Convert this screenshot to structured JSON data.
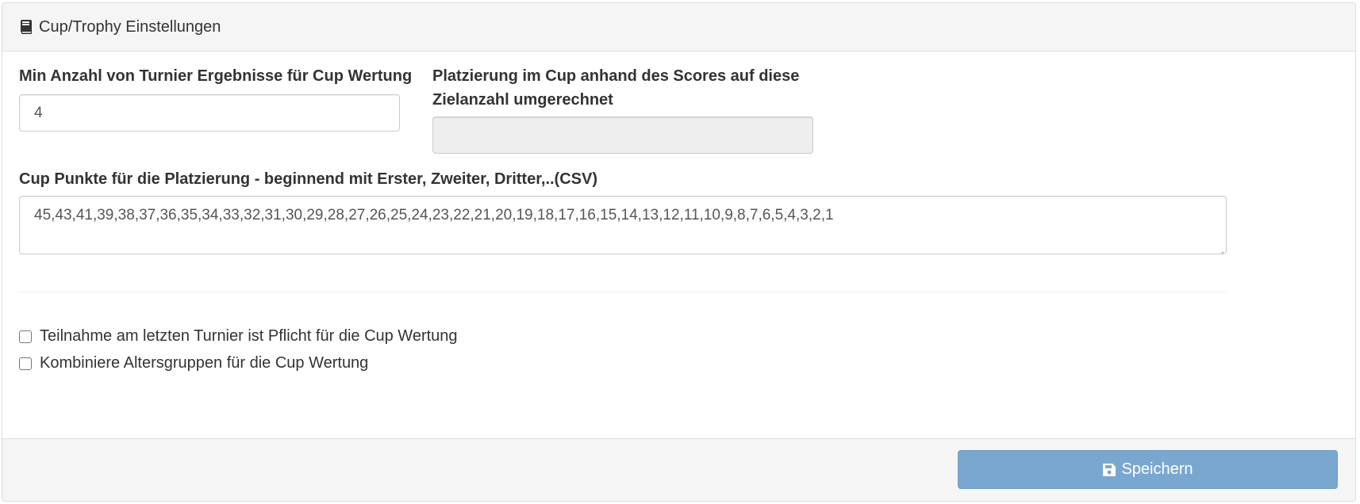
{
  "panel": {
    "title": "Cup/Trophy Einstellungen",
    "title_icon": "book-icon"
  },
  "form": {
    "min_results": {
      "label": "Min Anzahl von Turnier Ergebnisse für Cup Wertung",
      "value": "4"
    },
    "placement": {
      "label_line1": "Platzierung im Cup anhand des Scores auf diese",
      "label_line2": "Zielanzahl umgerechnet",
      "value": "",
      "disabled": true
    },
    "cup_points": {
      "label": "Cup Punkte für die Platzierung - beginnend mit Erster, Zweiter, Dritter,..(CSV)",
      "value": "45,43,41,39,38,37,36,35,34,33,32,31,30,29,28,27,26,25,24,23,22,21,20,19,18,17,16,15,14,13,12,11,10,9,8,7,6,5,4,3,2,1"
    },
    "checkboxes": [
      {
        "label": "Teilnahme am letzten Turnier ist Pflicht für die Cup Wertung",
        "checked": false
      },
      {
        "label": "Kombiniere Altersgruppen für die Cup Wertung",
        "checked": false
      }
    ]
  },
  "footer": {
    "save_label": "Speichern",
    "save_icon": "floppy-disk-icon",
    "save_color": "#7aa7d0"
  }
}
